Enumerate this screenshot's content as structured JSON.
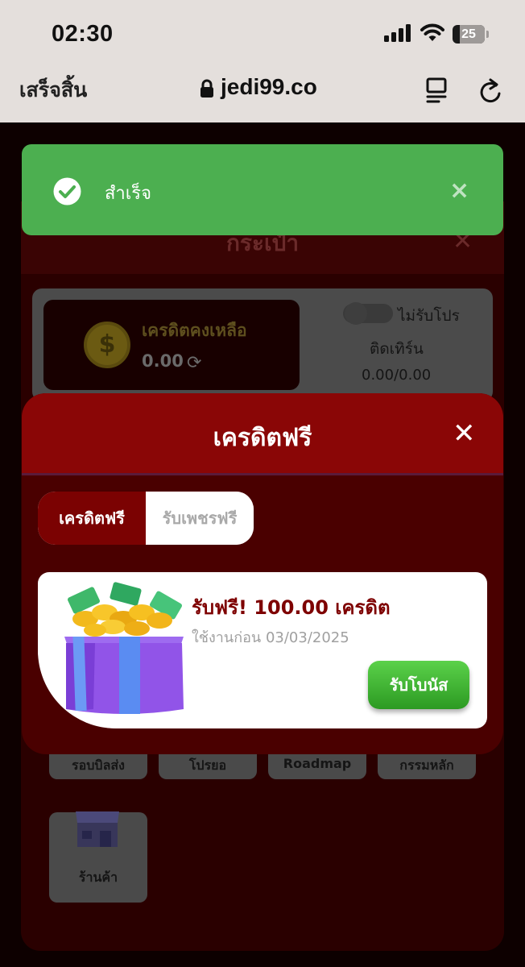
{
  "status_bar": {
    "time": "02:30",
    "battery": "25"
  },
  "browser": {
    "done_label": "เสร็จสิ้น",
    "url": "jedi99.co"
  },
  "background": {
    "title": "กระเป๋า",
    "credit_label": "เครดิตคงเหลือ",
    "credit_value": "0.00",
    "promo_label": "ไม่รับโปร",
    "turnover_label": "ติดเทิร์น",
    "turnover_value": "0.00/0.00",
    "tiles": [
      "รอบบิลส่ง",
      "โปรยอ",
      "Roadmap",
      "กรรมหลัก",
      "ร้านค้า"
    ]
  },
  "toast": {
    "message": "สำเร็จ",
    "close_icon": "×"
  },
  "modal": {
    "title": "เครดิตฟรี",
    "close_icon": "✕",
    "tabs": [
      {
        "label": "เครดิตฟรี",
        "active": true
      },
      {
        "label": "รับเพชรฟรี",
        "active": false
      }
    ],
    "bonus": {
      "title": "รับฟรี! 100.00 เครดิต",
      "expiry": "ใช้งานก่อน 03/03/2025",
      "button": "รับโบนัส"
    }
  },
  "colors": {
    "toast_green": "#4caf50",
    "modal_header": "#8a0606",
    "modal_body": "#4a0000",
    "claim_button": "#3db52f",
    "bonus_title": "#7e0000"
  }
}
